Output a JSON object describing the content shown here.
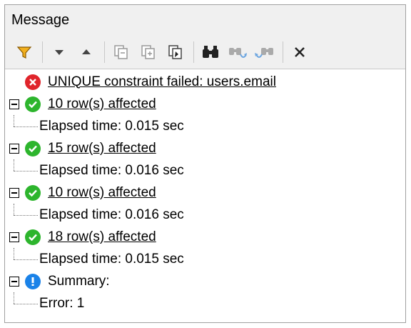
{
  "window": {
    "title": "Message"
  },
  "toolbar": {
    "buttons": [
      {
        "icon": "filter-icon"
      },
      {
        "icon": "arrow-down-icon"
      },
      {
        "icon": "arrow-up-icon"
      },
      {
        "icon": "copy-icon"
      },
      {
        "icon": "copy-all-icon"
      },
      {
        "icon": "copy-selected-icon"
      },
      {
        "icon": "find-icon"
      },
      {
        "icon": "find-next-icon"
      },
      {
        "icon": "find-previous-icon"
      },
      {
        "icon": "close-icon"
      }
    ]
  },
  "messages": [
    {
      "type": "error",
      "text": "UNIQUE constraint failed: users.email"
    },
    {
      "type": "success",
      "text": "10 row(s) affected",
      "detail": "Elapsed time: 0.015 sec"
    },
    {
      "type": "success",
      "text": "15 row(s) affected",
      "detail": "Elapsed time: 0.016 sec"
    },
    {
      "type": "success",
      "text": "10 row(s) affected",
      "detail": "Elapsed time: 0.016 sec"
    },
    {
      "type": "success",
      "text": "18 row(s) affected",
      "detail": "Elapsed time: 0.015 sec"
    },
    {
      "type": "info",
      "text": "Summary:",
      "detail": "Error: 1"
    }
  ],
  "colors": {
    "error": "#e0242b",
    "success": "#2db52d",
    "info": "#1a82e8",
    "accent": "#e8a000"
  }
}
